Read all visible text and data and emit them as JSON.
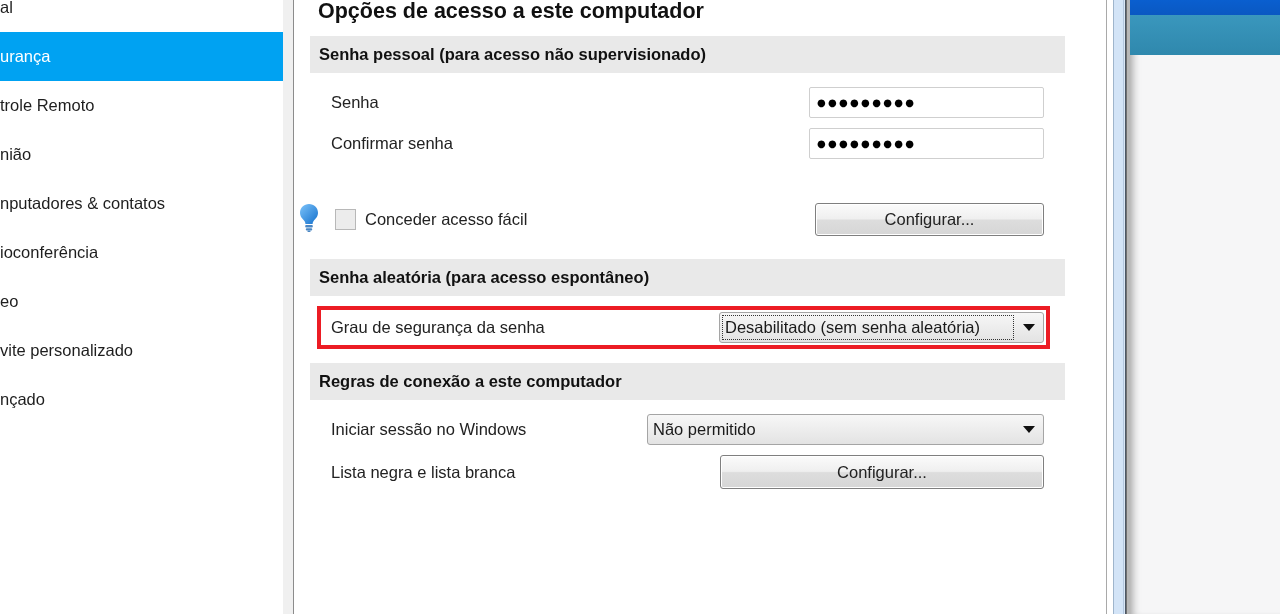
{
  "sidebar": {
    "items": [
      {
        "label": "al",
        "selected": false
      },
      {
        "label": "urança",
        "selected": true
      },
      {
        "label": "trole Remoto",
        "selected": false
      },
      {
        "label": "nião",
        "selected": false
      },
      {
        "label": "nputadores & contatos",
        "selected": false
      },
      {
        "label": "ioconferência",
        "selected": false
      },
      {
        "label": "eo",
        "selected": false
      },
      {
        "label": "vite personalizado",
        "selected": false
      },
      {
        "label": "nçado",
        "selected": false
      }
    ]
  },
  "panel": {
    "title": "Opções de acesso a este computador",
    "sections": [
      {
        "heading": "Senha pessoal (para acesso não supervisionado)",
        "rows": [
          {
            "kind": "password",
            "label": "Senha",
            "value": "●●●●●●●●●",
            "highlighted": false
          },
          {
            "kind": "password",
            "label": "Confirmar senha",
            "value": "●●●●●●●●●",
            "highlighted": false
          },
          {
            "kind": "checkbox",
            "label": "Conceder acesso fácil",
            "checked": false,
            "button": "Configurar...",
            "highlighted": false
          }
        ]
      },
      {
        "heading": "Senha aleatória (para acesso espontâneo)",
        "rows": [
          {
            "kind": "select",
            "label": "Grau de segurança da senha",
            "value": "Desabilitado (sem senha aleatória)",
            "focused": true,
            "highlighted": true
          }
        ]
      },
      {
        "heading": "Regras de conexão a este computador",
        "rows": [
          {
            "kind": "select",
            "label": "Iniciar sessão no Windows",
            "value": "Não permitido",
            "focused": false,
            "highlighted": false
          },
          {
            "kind": "button",
            "label": "Lista negra e lista branca",
            "button": "Configurar...",
            "highlighted": false
          }
        ]
      }
    ]
  }
}
